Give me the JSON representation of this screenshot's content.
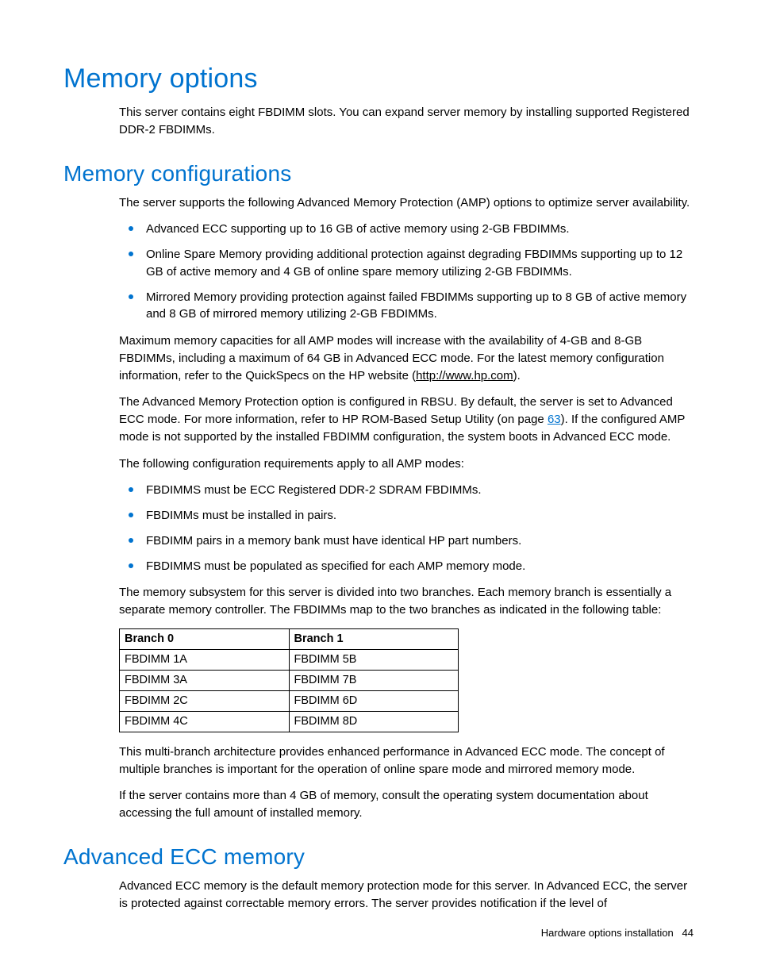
{
  "title": "Memory options",
  "intro": "This server contains eight FBDIMM slots. You can expand server memory by installing supported Registered DDR-2 FBDIMMs.",
  "section_configs": {
    "heading": "Memory configurations",
    "p1": "The server supports the following Advanced Memory Protection (AMP) options to optimize server availability.",
    "bullets1": [
      "Advanced ECC supporting up to 16 GB of active memory using 2-GB FBDIMMs.",
      "Online Spare Memory providing additional protection against degrading FBDIMMs supporting up to 12 GB of active memory and 4 GB of online spare memory utilizing 2-GB FBDIMMs.",
      "Mirrored Memory providing protection against failed FBDIMMs supporting up to 8 GB of active memory and 8 GB of mirrored memory utilizing 2-GB FBDIMMs."
    ],
    "p2_pre": "Maximum memory capacities for all AMP modes will increase with the availability of 4-GB and 8-GB FBDIMMs, including a maximum of 64 GB in Advanced ECC mode. For the latest memory configuration information, refer to the QuickSpecs on the HP website (",
    "p2_link": "http://www.hp.com",
    "p2_post": ").",
    "p3_pre": "The Advanced Memory Protection option is configured in RBSU. By default, the server is set to Advanced ECC mode. For more information, refer to HP ROM-Based Setup Utility (on page ",
    "p3_link": "63",
    "p3_post": "). If the configured AMP mode is not supported by the installed FBDIMM configuration, the system boots in Advanced ECC mode.",
    "p4": "The following configuration requirements apply to all AMP modes:",
    "bullets2": [
      "FBDIMMS must be ECC Registered DDR-2 SDRAM FBDIMMs.",
      "FBDIMMs must be installed in pairs.",
      "FBDIMM pairs in a memory bank must have identical HP part numbers.",
      "FBDIMMS must be populated as specified for each AMP memory mode."
    ],
    "p5": "The memory subsystem for this server is divided into two branches. Each memory branch is essentially a separate memory controller. The FBDIMMs map to the two branches as indicated in the following table:",
    "table": {
      "headers": [
        "Branch 0",
        "Branch 1"
      ],
      "rows": [
        [
          "FBDIMM 1A",
          "FBDIMM 5B"
        ],
        [
          "FBDIMM 3A",
          "FBDIMM 7B"
        ],
        [
          "FBDIMM 2C",
          "FBDIMM 6D"
        ],
        [
          "FBDIMM 4C",
          "FBDIMM 8D"
        ]
      ]
    },
    "p6": "This multi-branch architecture provides enhanced performance in Advanced ECC mode. The concept of multiple branches is important for the operation of online spare mode and mirrored memory mode.",
    "p7": "If the server contains more than 4 GB of memory, consult the operating system documentation about accessing the full amount of installed memory."
  },
  "section_ecc": {
    "heading": "Advanced ECC memory",
    "p1": "Advanced ECC memory is the default memory protection mode for this server. In Advanced ECC, the server is protected against correctable memory errors. The server provides notification if the level of"
  },
  "footer": {
    "section": "Hardware options installation",
    "page": "44"
  }
}
